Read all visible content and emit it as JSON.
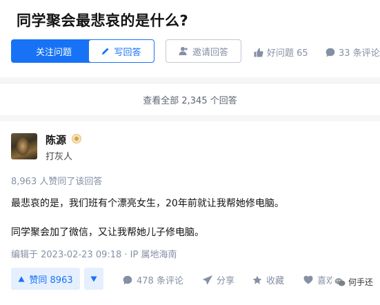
{
  "question": {
    "title": "同学聚会最悲哀的是什么?",
    "follow_label": "关注问题",
    "write_label": "写回答",
    "invite_label": "邀请回答",
    "good_question": "好问题 65",
    "comments": "33 条评论",
    "view_all": "查看全部 2,345 个回答"
  },
  "answer": {
    "author_name": "陈源",
    "author_desc": "打灰人",
    "voters": "8,963 人赞同了该回答",
    "paragraphs": [
      "最悲哀的是，我们班有个漂亮女生，20年前就让我帮她修电脑。",
      "同学聚会加了微信，又让我帮她儿子修电脑。"
    ],
    "edited": "编辑于 2023-02-23 09:18 · IP 属地海南",
    "vote_label": "赞同 8963",
    "comments": "478 条评论",
    "share": "分享",
    "favorite": "收藏",
    "like": "喜欢"
  },
  "watermark": "何手还",
  "colors": {
    "brand": "#1772f6",
    "muted": "#8590a6",
    "vote_bg": "#e5effe"
  },
  "icons": [
    "pencil-icon",
    "person-add-icon",
    "thumb-up-icon",
    "comment-bubble-icon",
    "triangle-up-icon",
    "triangle-down-icon",
    "paper-plane-icon",
    "star-icon",
    "heart-icon",
    "wechat-icon",
    "badge-icon"
  ]
}
